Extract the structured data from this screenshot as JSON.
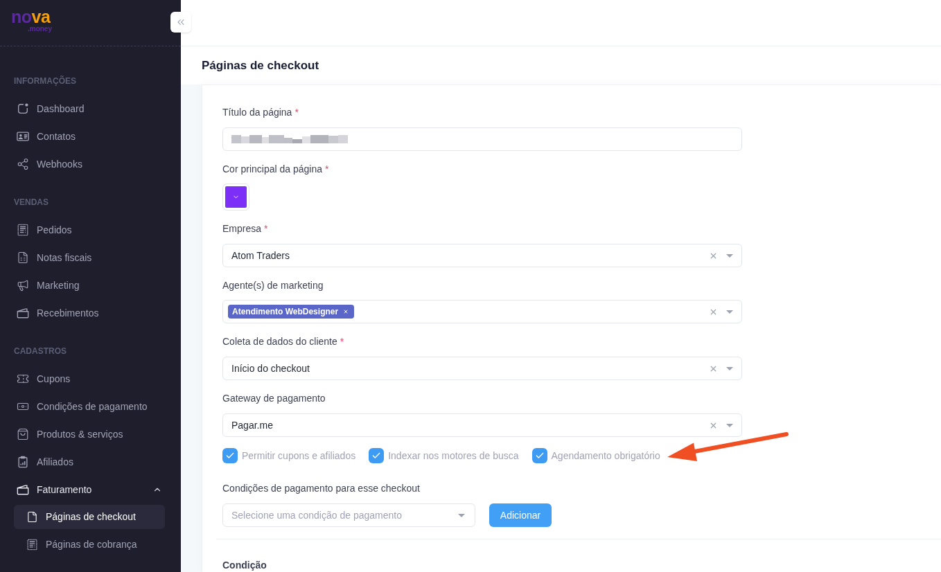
{
  "logo": {
    "primary": "no",
    "accent": "va",
    "domain": ".money"
  },
  "sidebar": {
    "sections": [
      {
        "title": "INFORMAÇÕES",
        "items": [
          {
            "label": "Dashboard",
            "selected": false
          },
          {
            "label": "Contatos",
            "selected": false
          },
          {
            "label": "Webhooks",
            "selected": false
          }
        ]
      },
      {
        "title": "VENDAS",
        "items": [
          {
            "label": "Pedidos",
            "selected": false
          },
          {
            "label": "Notas fiscais",
            "selected": false
          },
          {
            "label": "Marketing",
            "selected": false
          },
          {
            "label": "Recebimentos",
            "selected": false
          }
        ]
      },
      {
        "title": "CADASTROS",
        "items": [
          {
            "label": "Cupons",
            "selected": false
          },
          {
            "label": "Condições de pagamento",
            "selected": false
          },
          {
            "label": "Produtos & serviços",
            "selected": false
          },
          {
            "label": "Afiliados",
            "selected": false
          },
          {
            "label": "Faturamento",
            "selected": false,
            "expanded": true,
            "children": [
              {
                "label": "Páginas de checkout",
                "selected": true
              },
              {
                "label": "Páginas de cobrança",
                "selected": false
              }
            ]
          }
        ]
      }
    ]
  },
  "page_title": "Páginas de checkout",
  "form": {
    "fields": [
      {
        "kind": "text",
        "label": "Título da página",
        "required_mark": "*",
        "redacted": true
      },
      {
        "kind": "color",
        "label": "Cor principal da página",
        "required_mark": "*",
        "color": "#7b2ff7"
      },
      {
        "kind": "select",
        "label": "Empresa",
        "required_mark": "*",
        "value": "Atom Traders"
      },
      {
        "kind": "multiselect",
        "label": "Agente(s) de marketing",
        "tags": [
          "Atendimento WebDesigner"
        ]
      },
      {
        "kind": "select",
        "label": "Coleta de dados do cliente",
        "required_mark": "*",
        "value": "Início do checkout"
      },
      {
        "kind": "select",
        "label": "Gateway de pagamento",
        "value": "Pagar.me"
      }
    ],
    "options": [
      {
        "label": "Permitir cupons e afiliados",
        "checked": true
      },
      {
        "label": "Indexar nos motores de busca",
        "checked": true
      },
      {
        "label": "Agendamento obrigatório",
        "checked": true
      }
    ],
    "payment_conditions": {
      "label": "Condições de pagamento para esse checkout",
      "placeholder": "Selecione uma condição de pagamento",
      "button": "Adicionar"
    },
    "next_section": {
      "title": "Condição"
    }
  }
}
